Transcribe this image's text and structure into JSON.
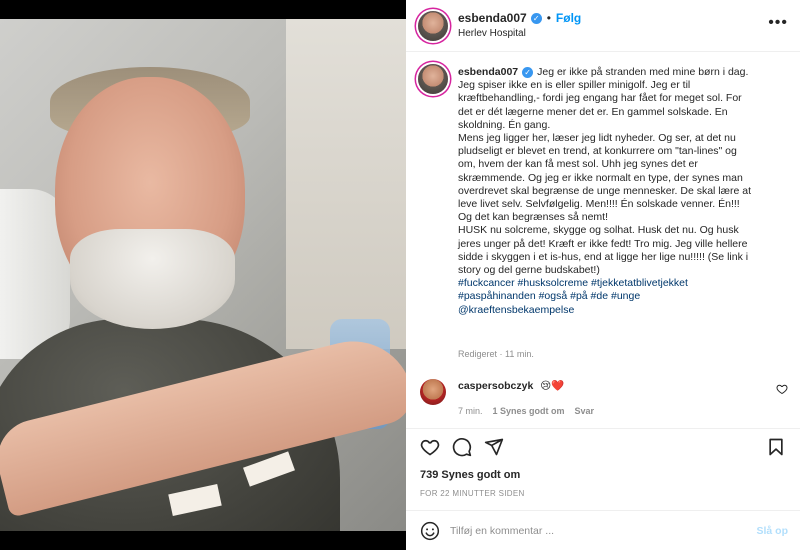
{
  "post": {
    "username": "esbenda007",
    "follow_label": "Følg",
    "separator": "•",
    "location": "Herlev Hospital"
  },
  "caption": {
    "username": "esbenda007",
    "lines": [
      "Jeg er ikke på stranden med mine børn i dag.",
      "Jeg spiser ikke en is eller spiller minigolf. Jeg er til",
      "kræftbehandling,- fordi jeg engang har fået for meget sol. For",
      "det er dét lægerne mener det er. En gammel solskade. En",
      "skoldning. Én gang.",
      "Mens jeg ligger her, læser jeg lidt nyheder. Og ser, at det nu",
      "pludseligt er blevet en trend, at konkurrere om \"tan-lines\" og",
      "om, hvem der kan få mest sol. Uhh jeg synes det er",
      "skræmmende. Og jeg er ikke normalt en type, der synes man",
      "overdrevet skal begrænse de unge mennesker. De skal lære at",
      "leve livet selv. Selvfølgelig. Men!!!! Én solskade venner. Én!!!",
      "Og det kan begrænses så nemt!",
      "HUSK nu solcreme, skygge og solhat. Husk det nu. Og husk",
      "jeres unger på det! Kræft er ikke fedt! Tro mig. Jeg ville hellere",
      "sidde i skyggen i et is-hus, end at ligge her lige nu!!!!! (Se link i",
      "story og del gerne budskabet!)"
    ],
    "hashtag_lines": [
      "#fuckcancer #husksolcreme #tjekketatblivetjekket",
      "#paspåhinanden #også #på #de #unge",
      "@kraeftensbekaempelse"
    ],
    "meta": "Redigeret · 11 min."
  },
  "comment": {
    "username": "caspersobczyk",
    "text": "😢❤️",
    "time": "7 min.",
    "likes": "1 Synes godt om",
    "reply": "Svar"
  },
  "actions": {
    "likes_count": "739 Synes godt om",
    "timestamp": "FOR 22 MINUTTER SIDEN"
  },
  "add_comment": {
    "placeholder": "Tilføj en kommentar ...",
    "post_label": "Slå op"
  },
  "icons": {
    "verified": "verified-badge-icon",
    "more": "more-options-icon",
    "like": "heart-icon",
    "comment": "comment-bubble-icon",
    "share": "paper-plane-icon",
    "save": "bookmark-icon",
    "emoji": "emoji-smiley-icon"
  },
  "colors": {
    "accent": "#0095f6",
    "verified": "#3897f0",
    "hashtag": "#00376b",
    "muted": "#8e8e8e",
    "heart": "#ed4956"
  }
}
